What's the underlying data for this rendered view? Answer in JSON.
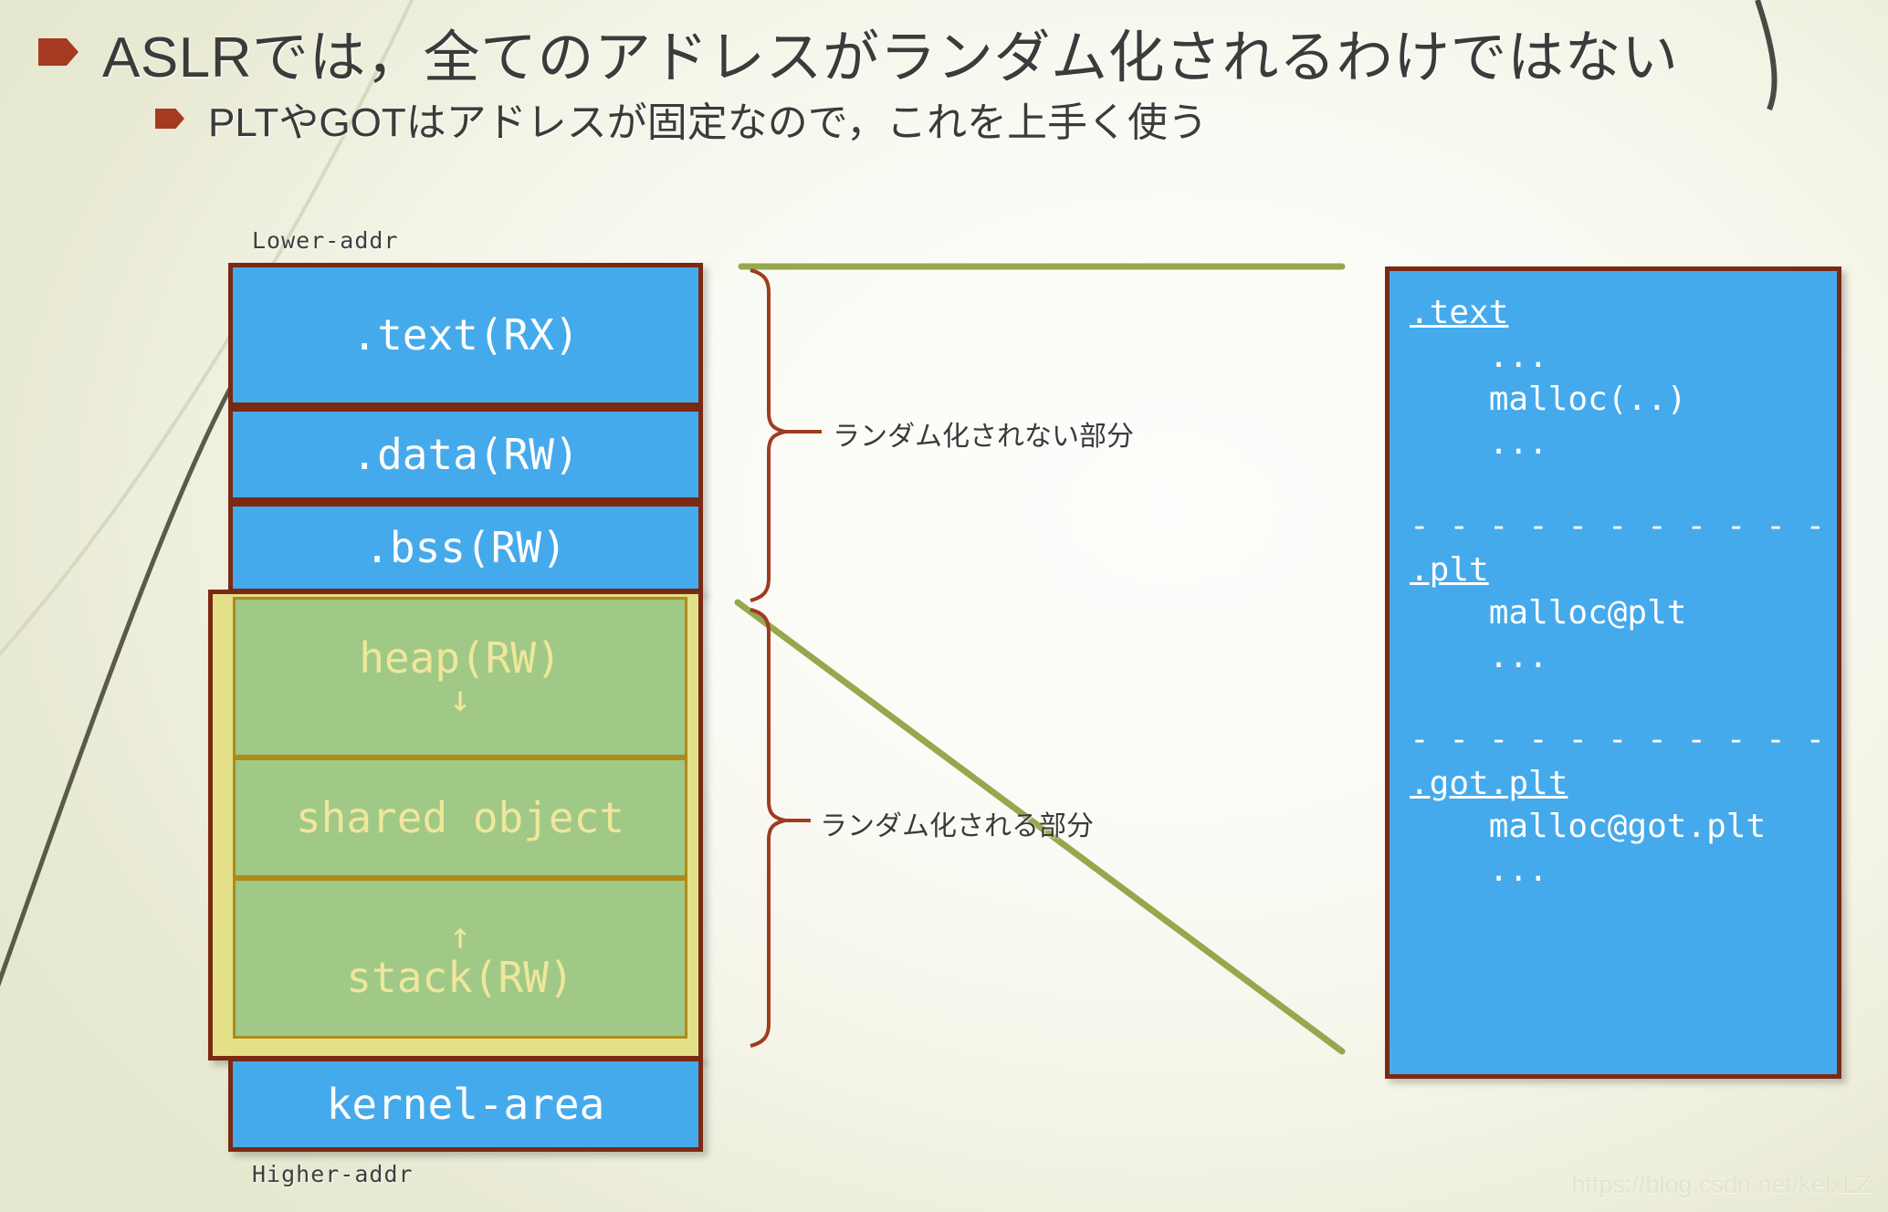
{
  "slide": {
    "title": "ASLRでは，全てのアドレスがランダム化されるわけではない",
    "subtitle": "PLTやGOTはアドレスが固定なので，これを上手く使う",
    "watermark": "https://blog.csdn.net/kelxLZ"
  },
  "memory_map": {
    "lower_addr_label": "Lower-addr",
    "higher_addr_label": "Higher-addr",
    "fixed_regions": [
      {
        "label": ".text(RX)"
      },
      {
        "label": ".data(RW)"
      },
      {
        "label": ".bss(RW)"
      }
    ],
    "randomized_regions": [
      {
        "label": "heap(RW)",
        "arrow": "↓",
        "arrow_position": "below"
      },
      {
        "label": "shared object",
        "arrow": "",
        "arrow_position": "none"
      },
      {
        "label": "stack(RW)",
        "arrow": "↑",
        "arrow_position": "above"
      }
    ],
    "kernel_region": {
      "label": "kernel-area"
    }
  },
  "annotations": {
    "fixed_part": "ランダム化されない部分",
    "randomized_part": "ランダム化される部分"
  },
  "code_panel": {
    "lines": [
      {
        "text": ".text",
        "style": "section"
      },
      {
        "text": "    ...",
        "style": "plain"
      },
      {
        "text": "    malloc(..)",
        "style": "plain"
      },
      {
        "text": "    ...",
        "style": "plain"
      },
      {
        "text": "",
        "style": "gap"
      },
      {
        "text": "- - - - - - - - - - - - - - - -",
        "style": "separator"
      },
      {
        "text": ".plt",
        "style": "section"
      },
      {
        "text": "    malloc@plt",
        "style": "plain"
      },
      {
        "text": "    ...",
        "style": "plain"
      },
      {
        "text": "",
        "style": "gap"
      },
      {
        "text": "- - - - - - - - - - - - - - - -",
        "style": "separator"
      },
      {
        "text": ".got.plt",
        "style": "section"
      },
      {
        "text": "    malloc@got.plt",
        "style": "plain"
      },
      {
        "text": "    ...",
        "style": "plain"
      }
    ]
  },
  "colors": {
    "fixed_fill": "#45AAEB",
    "randomized_fill": "#A0C987",
    "randomized_frame": "#E3E08A",
    "box_border": "#7A2A12",
    "inner_border": "#B08A18",
    "bullet": "#A63A20",
    "bracket": "#A03B22",
    "connector": "#96A84E",
    "background": "#EDEEDB"
  }
}
